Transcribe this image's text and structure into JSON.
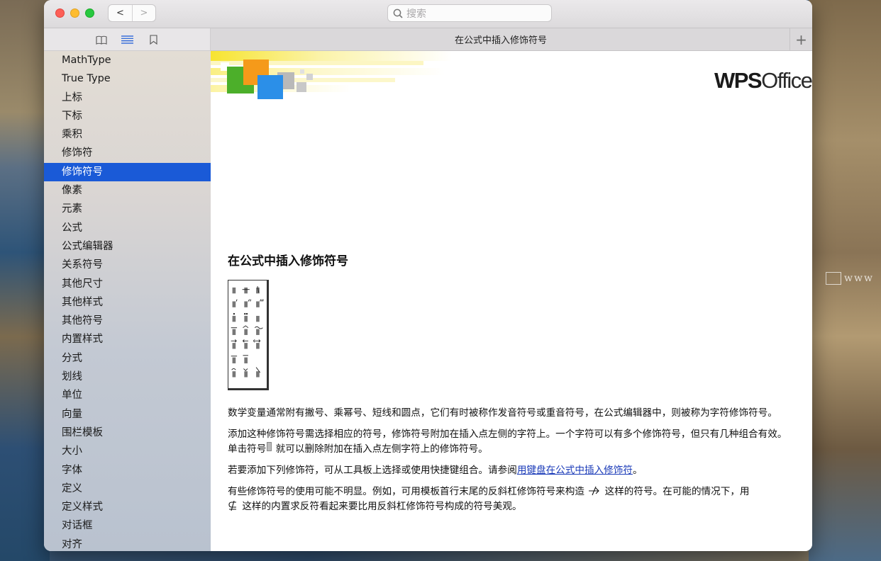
{
  "search": {
    "placeholder": "搜索"
  },
  "tab": {
    "title": "在公式中插入修饰符号",
    "add_label": "+"
  },
  "nav": {
    "back": "<",
    "forward": ">"
  },
  "sidebar": {
    "items": [
      "MathType",
      "True Type",
      "上标",
      "下标",
      "乘积",
      "修饰符",
      "修饰符号",
      "像素",
      "元素",
      "公式",
      "公式编辑器",
      "关系符号",
      "其他尺寸",
      "其他样式",
      "其他符号",
      "内置样式",
      "分式",
      "划线",
      "单位",
      "向量",
      "围栏模板",
      "大小",
      "字体",
      "定义",
      "定义样式",
      "对话框",
      "对齐"
    ],
    "selected_index": 6
  },
  "banner": {
    "logo_bold": "WPS",
    "logo_light": "Office"
  },
  "article": {
    "heading": "在公式中插入修饰符号",
    "p1": "数学变量通常附有撇号、乘幂号、短线和圆点，它们有时被称作发音符号或重音符号，在公式编辑器中，则被称为字符修饰符号。",
    "p2a": "添加这种修饰符号需选择相应的符号，修饰符号附加在插入点左侧的字符上。一个字符可以有多个修饰符号，但只有几种组合有效。单击符号",
    "p2b": "就可以删除附加在插入点左侧字符上的修饰符号。",
    "p3a": "若要添加下列修饰符，可从工具板上选择或使用快捷键组合。请参阅",
    "p3link": "用键盘在公式中插入修饰符",
    "p3b": "。",
    "p4a": "有些修饰符号的使用可能不明显。例如，可用模板首行末尾的反斜杠修饰符号来构造",
    "p4b": "这样的符号。在可能的情况下，用",
    "p4c": "这样的内置求反符看起来要比用反斜杠修饰符号构成的符号美观。"
  },
  "desktop": {
    "watermark": "www"
  },
  "colors": {
    "selection": "#1a5ad7",
    "link": "#1a3ab8"
  }
}
